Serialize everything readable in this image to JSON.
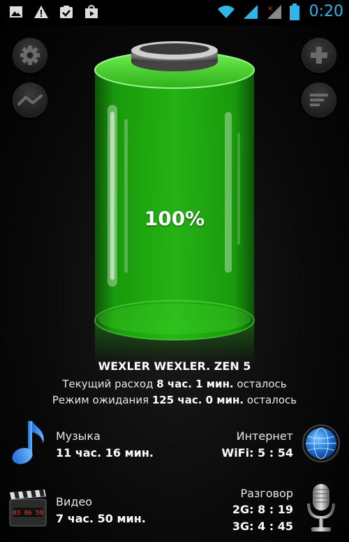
{
  "status_bar": {
    "left_icons": [
      "image-icon",
      "warning-icon",
      "clipboard-check-icon",
      "play-store-icon"
    ],
    "right_icons": [
      "wifi-icon",
      "signal-icon",
      "signal-no-data-icon",
      "battery-icon"
    ],
    "time": "0:20"
  },
  "controls": {
    "settings_icon": "gear-icon",
    "graph_icon": "line-chart-icon",
    "add_icon": "plus-icon",
    "menu_icon": "list-icon"
  },
  "battery": {
    "percent_label": "100%",
    "level": 1.0,
    "color": "#2ecc1a"
  },
  "device": {
    "name": "WEXLER WEXLER. ZEN 5",
    "current_prefix": "Текущий расход ",
    "current_value": "8 час. 1 мин.",
    "current_suffix": " осталось",
    "standby_prefix": "Режим ожидания ",
    "standby_value": "125 час. 0 мин.",
    "standby_suffix": " осталось"
  },
  "stats": {
    "music": {
      "title": "Музыка",
      "value": "11 час. 16 мин.",
      "icon": "music-note-icon"
    },
    "video": {
      "title": "Видео",
      "value": "7 час. 50 мин.",
      "icon": "clapperboard-icon",
      "clapper_text": "03 06 59"
    },
    "internet": {
      "title": "Интернет",
      "value": "WiFi: 5 : 54",
      "icon": "globe-icon"
    },
    "talk": {
      "title": "Разговор",
      "value_2g": "2G: 8 : 19",
      "value_3g": "3G: 4 : 45",
      "icon": "microphone-icon"
    }
  }
}
